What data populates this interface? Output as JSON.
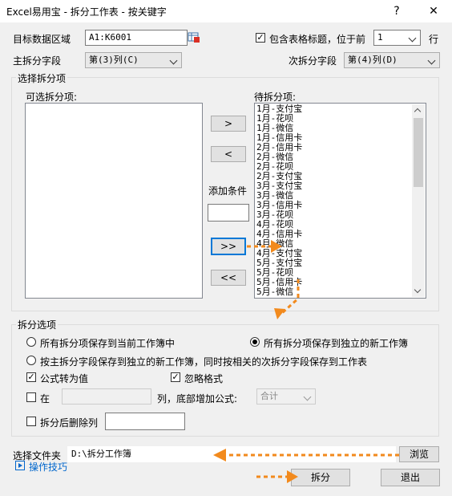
{
  "window": {
    "title": "Excel易用宝 - 拆分工作表 - 按关键字",
    "help": "?",
    "close": "✕"
  },
  "target": {
    "label": "目标数据区域",
    "value": "A1:K6001"
  },
  "header_opt": {
    "label": "包含表格标题，位于前",
    "checked": true,
    "rows_value": "1",
    "rows_suffix": "行"
  },
  "primary": {
    "label": "主拆分字段",
    "value": "第(3)列(C)"
  },
  "secondary": {
    "label": "次拆分字段",
    "value": "第(4)列(D)"
  },
  "select_group": {
    "title": "选择拆分项",
    "available_label": "可选拆分项:",
    "pending_label": "待拆分项:"
  },
  "pending_items": [
    "1月-支付宝",
    "1月-花呗",
    "1月-微信",
    "1月-信用卡",
    "2月-信用卡",
    "2月-微信",
    "2月-花呗",
    "2月-支付宝",
    "3月-支付宝",
    "3月-微信",
    "3月-信用卡",
    "3月-花呗",
    "4月-花呗",
    "4月-信用卡",
    "4月-微信",
    "4月-支付宝",
    "5月-支付宝",
    "5月-花呗",
    "5月-信用卡",
    "5月-微信"
  ],
  "move_buttons": {
    "add_one": ">",
    "remove_one": "<",
    "add_all": ">>",
    "remove_all": "<<"
  },
  "add_condition": {
    "label": "添加条件",
    "value": ""
  },
  "options": {
    "title": "拆分选项",
    "radio1": "所有拆分项保存到当前工作簿中",
    "radio2": "所有拆分项保存到独立的新工作簿",
    "radio3": "按主拆分字段保存到独立的新工作簿，同时按相关的次拆分字段保存到工作表",
    "formula_label": "公式转为值",
    "formula_checked": true,
    "ignore_label": "忽略格式",
    "ignore_checked": true,
    "in_label": "在",
    "in_value": "",
    "bottom_label": "列，底部增加公式:",
    "bottom_value": "合计",
    "delete_col_label": "拆分后删除列",
    "delete_col_value": ""
  },
  "folder": {
    "label": "选择文件夹",
    "value": "D:\\拆分工作簿",
    "browse": "浏览"
  },
  "tips": {
    "label": "操作技巧"
  },
  "actions": {
    "split": "拆分",
    "exit": "退出"
  },
  "colors": {
    "accent_arrow": "#f28a1d",
    "focus_border": "#0078d7",
    "link": "#0066cc"
  }
}
